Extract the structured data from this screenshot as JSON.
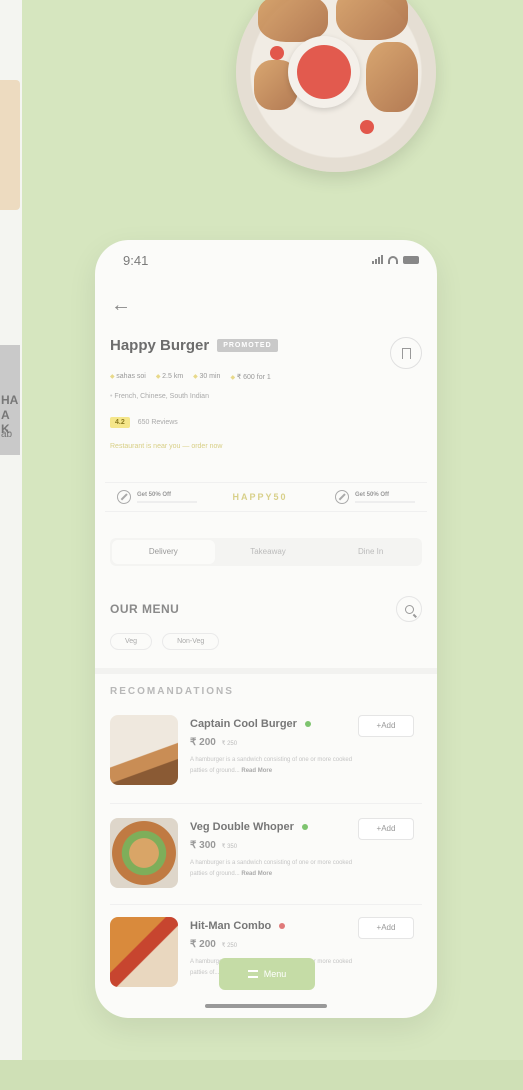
{
  "status_bar": {
    "time": "9:41"
  },
  "restaurant": {
    "name": "Happy Burger",
    "badge": "PROMOTED",
    "meta": [
      "sahas soi",
      "2.5 km",
      "30 min",
      "₹ 600 for 1"
    ],
    "cuisines": "French, Chinese, South Indian",
    "rating": "4.2",
    "reviews": "650 Reviews",
    "promo_line": "Restaurant is near you — order now"
  },
  "offers": {
    "left": {
      "title": "Get 50% Off",
      "sub": ""
    },
    "code": "HAPPY50",
    "right": {
      "title": "Get 50% Off",
      "sub": ""
    }
  },
  "tabs": [
    "Delivery",
    "Takeaway",
    "Dine In"
  ],
  "menu_section": {
    "title": "OUR MENU",
    "chips": [
      "Veg",
      "Non-Veg"
    ]
  },
  "recommendations": {
    "title": "RECOMANDATIONS",
    "items": [
      {
        "name": "Captain Cool Burger",
        "veg_color": "#7ec46f",
        "price": "₹ 200",
        "old_price": "₹ 250",
        "desc": "A hamburger is a sandwich consisting of one or more cooked patties of ground...",
        "read_more": "Read More",
        "add": "+Add"
      },
      {
        "name": "Veg Double Whoper",
        "veg_color": "#7ec46f",
        "price": "₹ 300",
        "old_price": "₹ 350",
        "desc": "A hamburger is a sandwich consisting of one or more cooked patties of ground...",
        "read_more": "Read More",
        "add": "+Add"
      },
      {
        "name": "Hit-Man Combo",
        "veg_color": "#e07a7a",
        "price": "₹ 200",
        "old_price": "₹ 250",
        "desc": "A hamburger is a sandwich consisting of one or more cooked patties of...",
        "read_more": "",
        "add": "+Add"
      }
    ]
  },
  "menu_button": "Menu",
  "background": {
    "side_text": [
      "HA",
      "A K",
      "ab"
    ]
  }
}
